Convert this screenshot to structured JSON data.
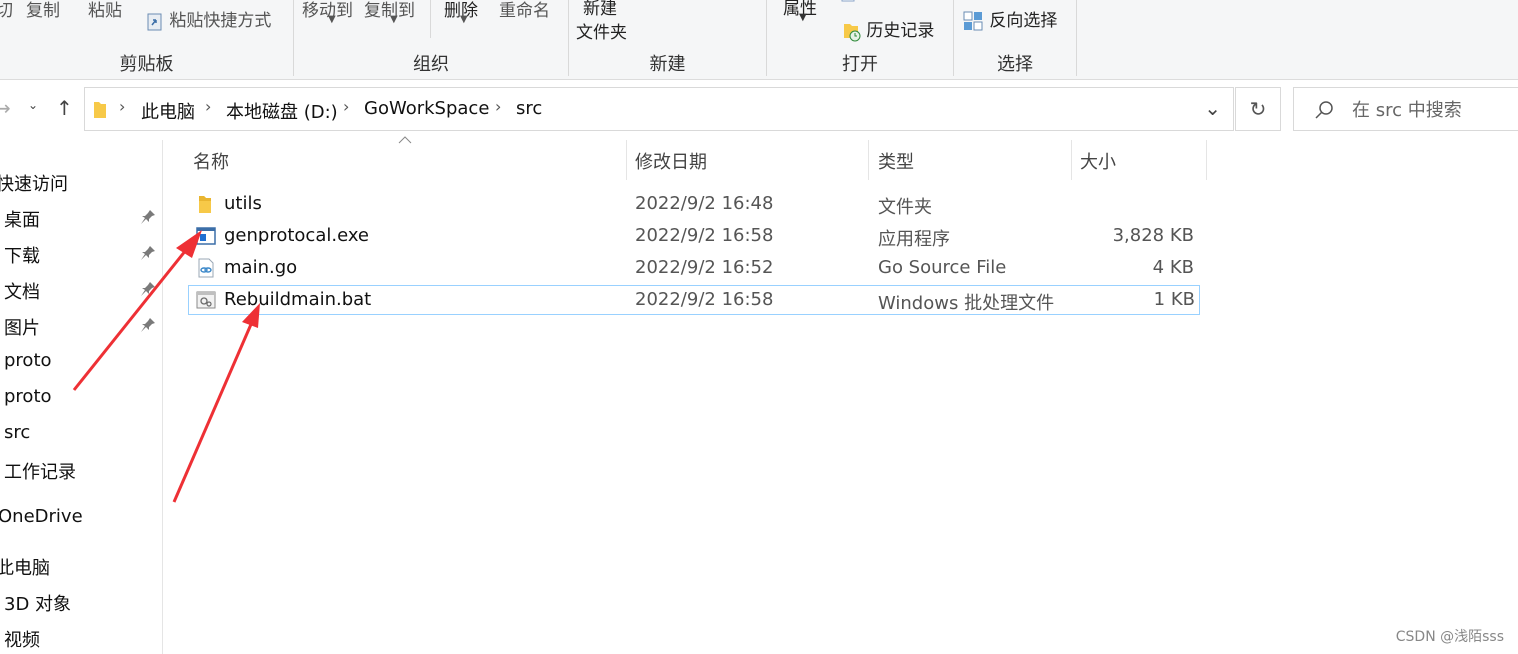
{
  "ribbon": {
    "clipboard": {
      "label": "剪贴板",
      "cut_partial": "切",
      "copy": "复制",
      "paste": "粘贴",
      "paste_shortcut": "粘贴快捷方式"
    },
    "organize": {
      "label": "组织",
      "move_to": "移动到",
      "copy_to": "复制到",
      "delete": "删除",
      "rename": "重命名"
    },
    "new": {
      "label": "新建",
      "new_folder_line1": "新建",
      "new_folder_line2": "文件夹"
    },
    "open": {
      "label": "打开",
      "properties": "属性",
      "history": "历史记录"
    },
    "select": {
      "label": "选择",
      "invert": "反向选择"
    }
  },
  "address": {
    "crumbs": [
      "此电脑",
      "本地磁盘 (D:)",
      "GoWorkSpace",
      "src"
    ]
  },
  "search": {
    "placeholder": "在 src 中搜索"
  },
  "sidebar": {
    "quick_access": "快速访问",
    "items": [
      "桌面",
      "下载",
      "文档",
      "图片",
      "proto",
      "proto",
      "src",
      "工作记录"
    ],
    "onedrive": "OneDrive",
    "this_pc": "此电脑",
    "pc_items": [
      "3D 对象",
      "视频"
    ]
  },
  "columns": {
    "name": "名称",
    "date": "修改日期",
    "type": "类型",
    "size": "大小"
  },
  "files": [
    {
      "name": "utils",
      "date": "2022/9/2 16:48",
      "type": "文件夹",
      "size": "",
      "icon": "folder-icon"
    },
    {
      "name": "genprotocal.exe",
      "date": "2022/9/2 16:58",
      "type": "应用程序",
      "size": "3,828 KB",
      "icon": "exe-icon"
    },
    {
      "name": "main.go",
      "date": "2022/9/2 16:52",
      "type": "Go Source File",
      "size": "4 KB",
      "icon": "go-file-icon"
    },
    {
      "name": "Rebuildmain.bat",
      "date": "2022/9/2 16:58",
      "type": "Windows 批处理文件",
      "size": "1 KB",
      "icon": "bat-icon"
    }
  ],
  "watermark": "CSDN @浅陌sss",
  "colors": {
    "accent_red": "#ee3035",
    "selection_border": "#99d1ff",
    "folder_yellow": "#f7c948"
  }
}
